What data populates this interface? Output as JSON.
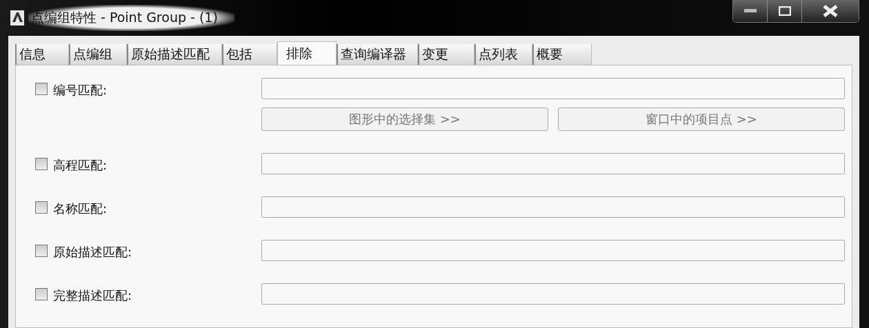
{
  "window": {
    "title": "点编组特性 - Point Group - (1)"
  },
  "tabs": [
    {
      "label": "信息",
      "selected": false
    },
    {
      "label": "点编组",
      "selected": false
    },
    {
      "label": "原始描述匹配",
      "selected": false
    },
    {
      "label": "包括",
      "selected": false
    },
    {
      "label": "排除",
      "selected": true
    },
    {
      "label": "查询编译器",
      "selected": false
    },
    {
      "label": "变更",
      "selected": false
    },
    {
      "label": "点列表",
      "selected": false
    },
    {
      "label": "概要",
      "selected": false
    }
  ],
  "rows": [
    {
      "label": "编号匹配:",
      "checked": false,
      "buttons": [
        {
          "label": "图形中的选择集 >>",
          "disabled": true
        },
        {
          "label": "窗口中的项目点 >>",
          "disabled": true
        }
      ]
    },
    {
      "label": "高程匹配:",
      "checked": false
    },
    {
      "label": "名称匹配:",
      "checked": false
    },
    {
      "label": "原始描述匹配:",
      "checked": false
    },
    {
      "label": "完整描述匹配:",
      "checked": false
    }
  ]
}
